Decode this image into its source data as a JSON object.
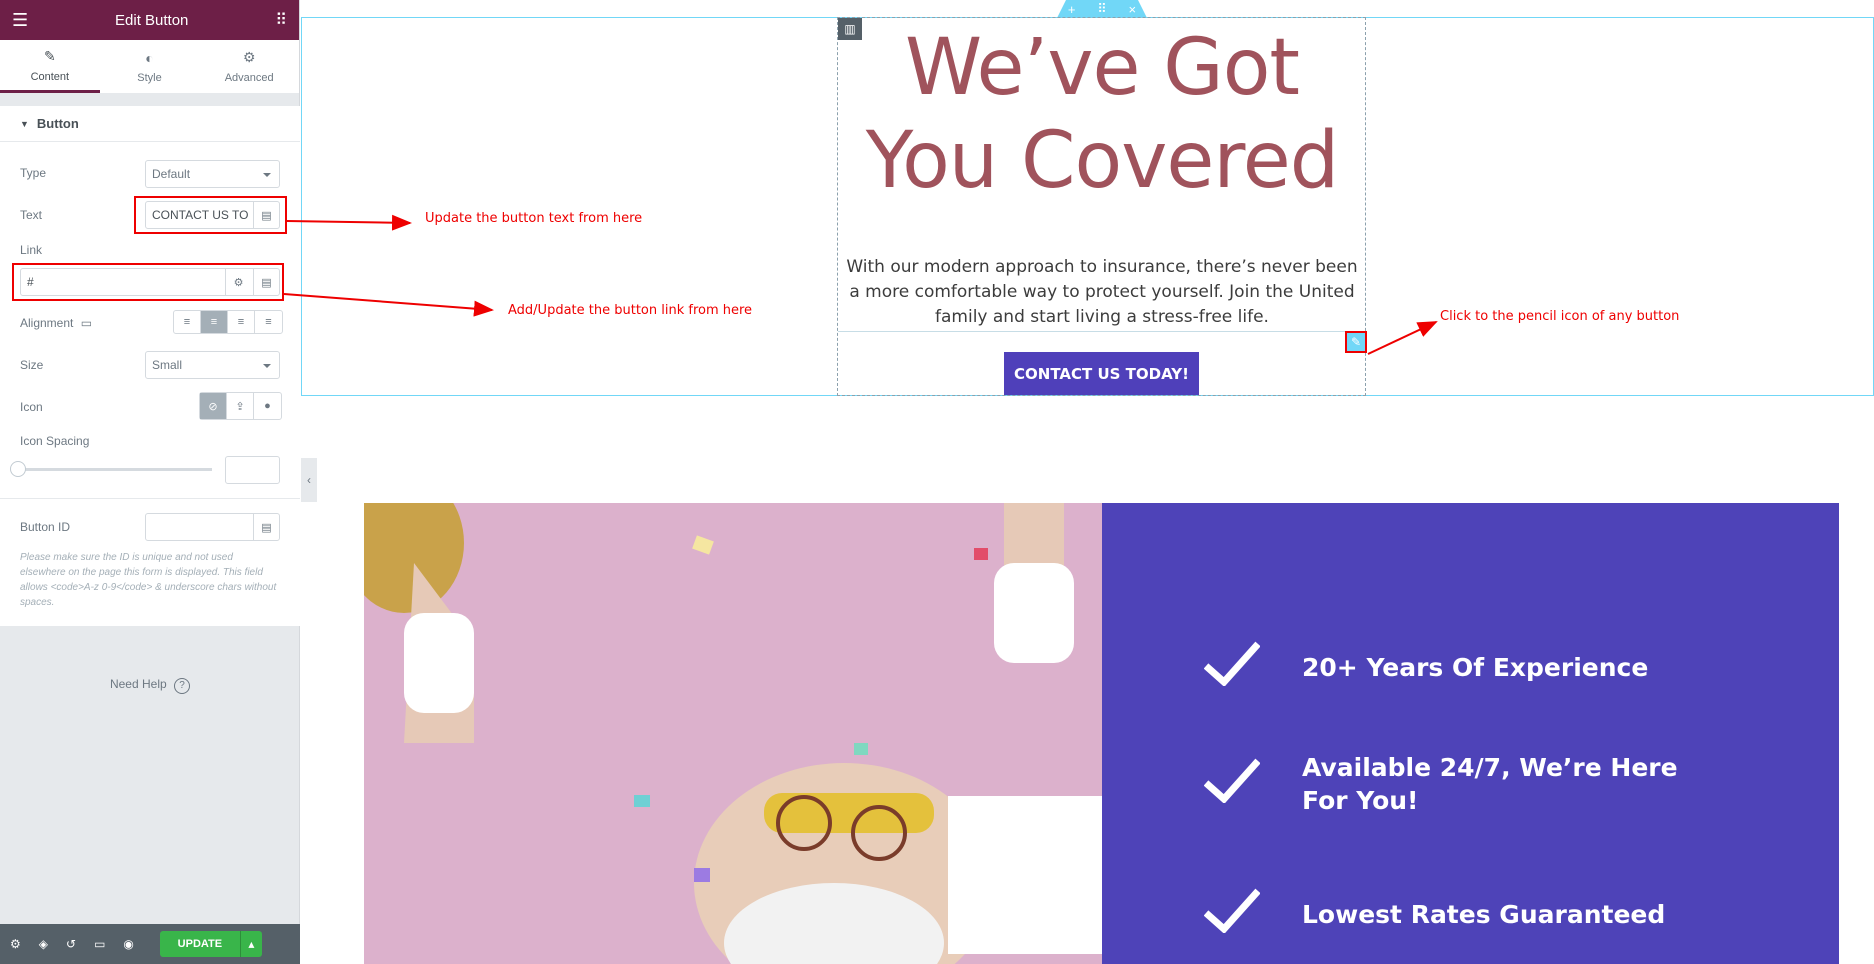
{
  "panel": {
    "title": "Edit Button",
    "tabs": [
      {
        "label": "Content",
        "icon": "pencil-icon"
      },
      {
        "label": "Style",
        "icon": "half-circle-icon"
      },
      {
        "label": "Advanced",
        "icon": "gear-icon"
      }
    ],
    "section_title": "Button",
    "type_label": "Type",
    "type_value": "Default",
    "text_label": "Text",
    "text_value": "CONTACT US TO",
    "link_label": "Link",
    "link_value": "#",
    "alignment_label": "Alignment",
    "size_label": "Size",
    "size_value": "Small",
    "icon_label": "Icon",
    "icon_spacing_label": "Icon Spacing",
    "button_id_label": "Button ID",
    "note": "Please make sure the ID is unique and not used elsewhere on the page this form is displayed. This field allows <code>A-z 0-9</code> & underscore chars without spaces.",
    "need_help": "Need Help",
    "update_label": "UPDATE"
  },
  "page": {
    "heading_line1": "We’ve Got",
    "heading_line2": "You Covered",
    "paragraph": "With our modern approach to insurance, there’s never been a more comfortable way to protect yourself. Join the United family and start living a stress-free life.",
    "button": "CONTACT US TODAY!",
    "features": [
      "20+ Years Of Experience",
      "Available 24/7, We’re Here For You!",
      "Lowest Rates Guaranteed"
    ]
  },
  "annotations": {
    "text": "Update the button text from here",
    "link": "Add/Update the button link from here",
    "pencil": "Click to the pencil icon of any button"
  },
  "colors": {
    "panel_header": "#6d1f47",
    "heading": "#a0535c",
    "cta": "#4f40ba",
    "feature_bg": "#4e43b8",
    "annotation": "#e00000",
    "update": "#39b54a"
  }
}
